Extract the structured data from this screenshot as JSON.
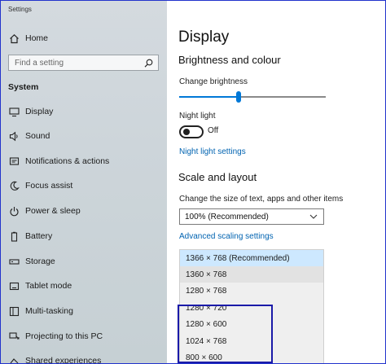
{
  "window": {
    "title": "Settings"
  },
  "sidebar": {
    "home_label": "Home",
    "search": {
      "placeholder": "Find a setting"
    },
    "section": "System",
    "items": [
      {
        "label": "Display",
        "icon": "monitor-icon"
      },
      {
        "label": "Sound",
        "icon": "speaker-icon"
      },
      {
        "label": "Notifications & actions",
        "icon": "notification-icon"
      },
      {
        "label": "Focus assist",
        "icon": "moon-icon"
      },
      {
        "label": "Power & sleep",
        "icon": "power-icon"
      },
      {
        "label": "Battery",
        "icon": "battery-icon"
      },
      {
        "label": "Storage",
        "icon": "storage-icon"
      },
      {
        "label": "Tablet mode",
        "icon": "tablet-icon"
      },
      {
        "label": "Multi-tasking",
        "icon": "multitask-icon"
      },
      {
        "label": "Projecting to this PC",
        "icon": "project-icon"
      },
      {
        "label": "Shared experiences",
        "icon": "shared-icon"
      }
    ]
  },
  "main": {
    "title": "Display",
    "brightness_heading": "Brightness and colour",
    "brightness_label": "Change brightness",
    "brightness_value": 0.4,
    "night_light_label": "Night light",
    "night_light_state": "Off",
    "night_light_link": "Night light settings",
    "scale_heading": "Scale and layout",
    "size_label": "Change the size of text, apps and other items",
    "size_value": "100% (Recommended)",
    "advanced_link": "Advanced scaling settings",
    "resolutions": [
      "1366 × 768 (Recommended)",
      "1360 × 768",
      "1280 × 768",
      "1280 × 720",
      "1280 × 600",
      "1024 × 768",
      "800 × 600"
    ],
    "selected_resolution": "1366 × 768 (Recommended)"
  },
  "colors": {
    "accent": "#0078d7",
    "link": "#0063b1",
    "highlight_border": "#1a1aa8"
  }
}
